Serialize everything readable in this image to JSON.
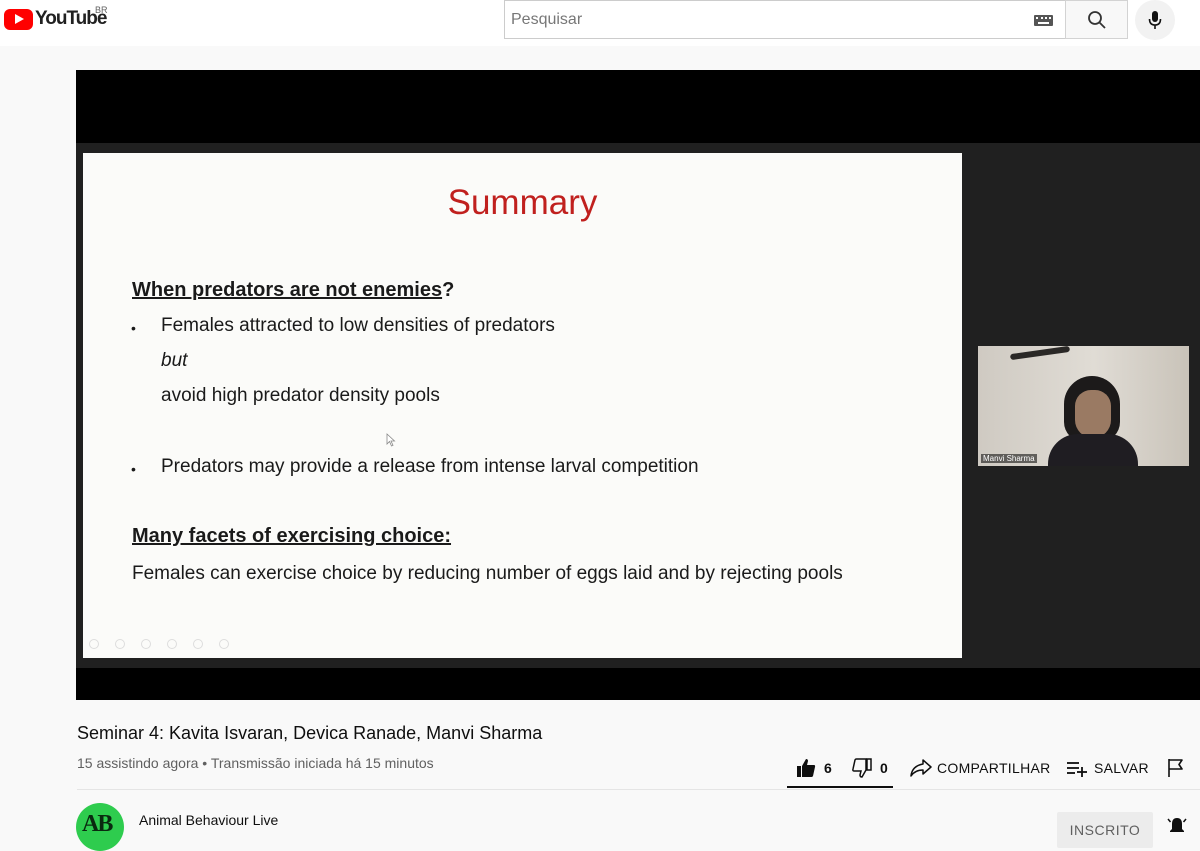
{
  "header": {
    "logo_text": "YouTube",
    "region": "BR",
    "search_placeholder": "Pesquisar"
  },
  "slide": {
    "title": "Summary",
    "section1_heading": "When predators are not enemies",
    "section1_heading_suffix": "?",
    "bullet1_line1": "Females attracted to low densities of predators",
    "bullet1_line2": "but",
    "bullet1_line3": "avoid high predator density pools",
    "bullet2": "Predators may provide a release from intense larval competition",
    "section2_heading": "Many facets of exercising choice:",
    "section2_text": "Females can exercise choice by reducing number of eggs laid and by rejecting pools",
    "bullet_symbol": "•"
  },
  "webcam": {
    "participant_name": "Manvi Sharma"
  },
  "video": {
    "title": "Seminar 4: Kavita Isvaran, Devica Ranade, Manvi Sharma",
    "meta": "15 assistindo agora • Transmissão iniciada há 15 minutos"
  },
  "actions": {
    "likes": "6",
    "dislikes": "0",
    "share_label": "COMPARTILHAR",
    "save_label": "SALVAR"
  },
  "channel": {
    "name": "Animal Behaviour Live",
    "avatar_text": "AB",
    "subscribe_label": "INSCRITO"
  },
  "colors": {
    "slide_title": "#c0201e",
    "logo_red": "#ff0000",
    "avatar_green": "#2ecc4e"
  }
}
